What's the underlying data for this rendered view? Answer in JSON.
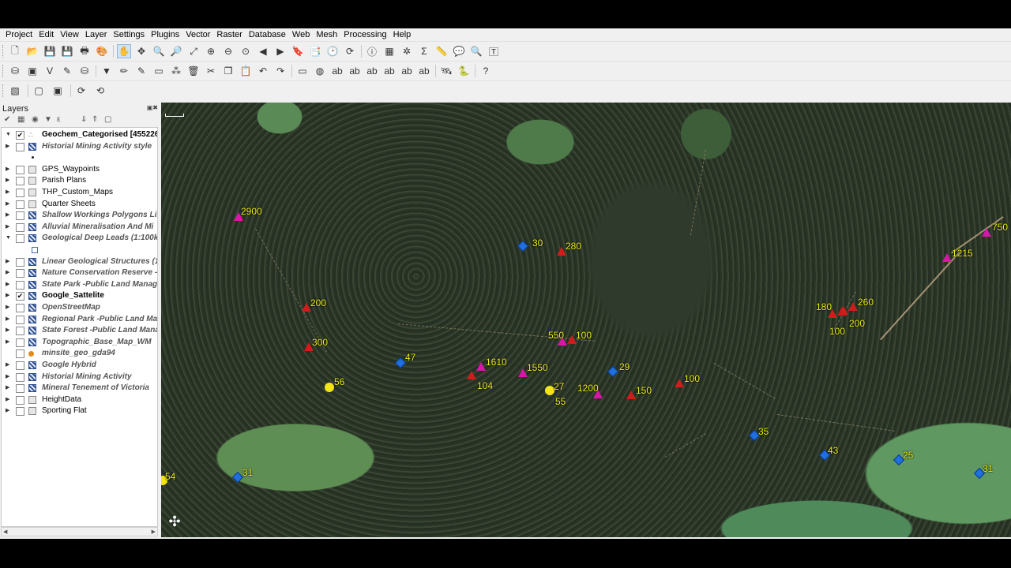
{
  "menu": [
    "Project",
    "Edit",
    "View",
    "Layer",
    "Settings",
    "Plugins",
    "Vector",
    "Raster",
    "Database",
    "Web",
    "Mesh",
    "Processing",
    "Help"
  ],
  "toolbar_icons": {
    "row1": [
      "new-project-icon",
      "open-project-icon",
      "save-project-icon",
      "save-as-icon",
      "print-layout-icon",
      "style-manager-icon",
      "pan-icon",
      "pan-to-selection-icon",
      "zoom-in-icon",
      "zoom-out-icon",
      "zoom-full-icon",
      "zoom-selection-icon",
      "zoom-layer-icon",
      "zoom-native-icon",
      "zoom-last-icon",
      "zoom-next-icon",
      "new-bookmark-icon",
      "show-bookmarks-icon",
      "temporal-controller-icon",
      "refresh-icon",
      "identify-icon",
      "attribute-table-icon",
      "field-calculator-icon",
      "statistics-icon",
      "measure-icon",
      "map-tips-icon",
      "annotation-icon",
      "text-annotation-icon"
    ],
    "row2": [
      "data-source-manager-icon",
      "new-geopackage-icon",
      "new-shapefile-icon",
      "new-spatialite-icon",
      "new-virtual-layer-icon",
      "digitize-icon",
      "edit-pencil-icon",
      "save-edits-icon",
      "add-feature-icon",
      "vertex-tool-icon",
      "delete-icon",
      "cut-icon",
      "copy-icon",
      "paste-icon",
      "undo-icon",
      "redo-icon",
      "label-tool-icon",
      "label-pin-icon",
      "label-highlight-icon",
      "label-show-hide-icon",
      "label-move-icon",
      "label-rotate-icon",
      "label-change-icon",
      "label-properties-icon",
      "gps-tool-icon",
      "python-console-icon",
      "help-icon"
    ],
    "row3": [
      "selection-tool-icon",
      "deselect-icon",
      "select-by-expression-icon",
      "refresh-a-icon",
      "refresh-b-icon"
    ]
  },
  "layers_panel": {
    "title": "Layers",
    "layers": [
      {
        "name": "Geochem_Categorised [455226",
        "checked": true,
        "bold": true,
        "italic": false,
        "expand": "open",
        "icon": "dotsic"
      },
      {
        "name": "Historial Mining Activity style",
        "checked": false,
        "bold": true,
        "italic": true,
        "expand": "closed",
        "icon": "raster"
      },
      {
        "name": "GPS_Waypoints",
        "checked": false,
        "bold": false,
        "italic": false,
        "expand": "closed",
        "icon": "vector"
      },
      {
        "name": "Parish Plans",
        "checked": false,
        "bold": false,
        "italic": false,
        "expand": "closed",
        "icon": "vector"
      },
      {
        "name": "THP_Custom_Maps",
        "checked": false,
        "bold": false,
        "italic": false,
        "expand": "closed",
        "icon": "vector"
      },
      {
        "name": "Quarter Sheets",
        "checked": false,
        "bold": false,
        "italic": false,
        "expand": "closed",
        "icon": "vector"
      },
      {
        "name": "Shallow Workings Polygons Lin",
        "checked": false,
        "bold": true,
        "italic": true,
        "expand": "closed",
        "icon": "raster"
      },
      {
        "name": "Alluvial Mineralisation And Mi",
        "checked": false,
        "bold": true,
        "italic": true,
        "expand": "closed",
        "icon": "raster"
      },
      {
        "name": "Geological Deep Leads (1:100k",
        "checked": false,
        "bold": true,
        "italic": true,
        "expand": "open",
        "icon": "raster"
      },
      {
        "name": "Linear Geological Structures (1",
        "checked": false,
        "bold": true,
        "italic": true,
        "expand": "closed",
        "icon": "raster"
      },
      {
        "name": "Nature Conservation Reserve -",
        "checked": false,
        "bold": true,
        "italic": true,
        "expand": "closed",
        "icon": "raster"
      },
      {
        "name": "State Park -Public Land Manag",
        "checked": false,
        "bold": true,
        "italic": true,
        "expand": "closed",
        "icon": "raster"
      },
      {
        "name": "Google_Sattelite",
        "checked": true,
        "bold": true,
        "italic": false,
        "expand": "closed",
        "icon": "raster"
      },
      {
        "name": "OpenStreetMap",
        "checked": false,
        "bold": true,
        "italic": true,
        "expand": "closed",
        "icon": "raster"
      },
      {
        "name": "Regional Park -Public Land Ma",
        "checked": false,
        "bold": true,
        "italic": true,
        "expand": "closed",
        "icon": "raster"
      },
      {
        "name": "State Forest -Public Land Mana",
        "checked": false,
        "bold": true,
        "italic": true,
        "expand": "closed",
        "icon": "raster"
      },
      {
        "name": "Topographic_Base_Map_WM",
        "checked": false,
        "bold": true,
        "italic": true,
        "expand": "closed",
        "icon": "raster"
      },
      {
        "name": "minsite_geo_gda94",
        "checked": false,
        "bold": true,
        "italic": true,
        "expand": "none",
        "icon": "pointic"
      },
      {
        "name": "Google Hybrid",
        "checked": false,
        "bold": true,
        "italic": true,
        "expand": "closed",
        "icon": "raster"
      },
      {
        "name": "Historial Mining Activity",
        "checked": false,
        "bold": true,
        "italic": true,
        "expand": "closed",
        "icon": "raster"
      },
      {
        "name": "Mineral Tenement of Victoria",
        "checked": false,
        "bold": true,
        "italic": true,
        "expand": "closed",
        "icon": "raster"
      },
      {
        "name": "HeightData",
        "checked": false,
        "bold": false,
        "italic": false,
        "expand": "closed",
        "icon": "vector"
      },
      {
        "name": "Sporting Flat",
        "checked": false,
        "bold": false,
        "italic": false,
        "expand": "closed",
        "icon": "vector"
      }
    ]
  },
  "map_features": [
    {
      "label": "2900",
      "type": "triangle",
      "color": "magenta"
    },
    {
      "label": "30",
      "type": "diamond",
      "color": "blue"
    },
    {
      "label": "280",
      "type": "triangle",
      "color": "red"
    },
    {
      "label": "750",
      "type": "triangle",
      "color": "magenta"
    },
    {
      "label": "1215",
      "type": "triangle",
      "color": "magenta"
    },
    {
      "label": "200",
      "type": "triangle",
      "color": "red"
    },
    {
      "label": "300",
      "type": "triangle",
      "color": "red"
    },
    {
      "label": "180",
      "type": "triangle",
      "color": "red"
    },
    {
      "label": "260",
      "type": "triangle",
      "color": "red"
    },
    {
      "label": "100",
      "type": "triangle",
      "color": "red"
    },
    {
      "label": "200",
      "type": "triangle",
      "color": "red"
    },
    {
      "label": "550",
      "type": "triangle",
      "color": "magenta"
    },
    {
      "label": "100",
      "type": "triangle",
      "color": "red"
    },
    {
      "label": "47",
      "type": "diamond",
      "color": "blue"
    },
    {
      "label": "1610",
      "type": "triangle",
      "color": "magenta"
    },
    {
      "label": "104",
      "type": "triangle",
      "color": "red"
    },
    {
      "label": "1550",
      "type": "triangle",
      "color": "magenta"
    },
    {
      "label": "29",
      "type": "diamond",
      "color": "blue"
    },
    {
      "label": "100",
      "type": "triangle",
      "color": "red"
    },
    {
      "label": "56",
      "type": "circle",
      "color": "yellow"
    },
    {
      "label": "27",
      "type": "circle",
      "color": "yellow"
    },
    {
      "label": "55",
      "type": "none",
      "color": "yellow"
    },
    {
      "label": "1200",
      "type": "triangle",
      "color": "magenta"
    },
    {
      "label": "150",
      "type": "triangle",
      "color": "red"
    },
    {
      "label": "35",
      "type": "diamond",
      "color": "blue"
    },
    {
      "label": "43",
      "type": "diamond",
      "color": "blue"
    },
    {
      "label": "25",
      "type": "diamond",
      "color": "blue"
    },
    {
      "label": "31",
      "type": "diamond",
      "color": "blue"
    },
    {
      "label": "54",
      "type": "circle",
      "color": "yellow"
    },
    {
      "label": "31",
      "type": "diamond",
      "color": "blue"
    }
  ]
}
